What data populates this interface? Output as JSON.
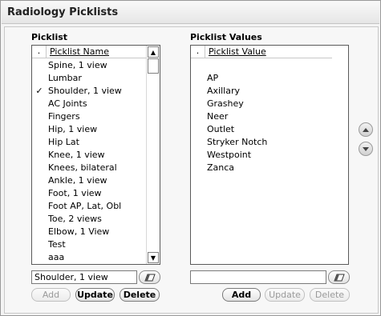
{
  "window": {
    "title": "Radiology Picklists"
  },
  "picklist": {
    "label": "Picklist",
    "header_check": ".",
    "header_name": "Picklist Name",
    "items": [
      {
        "check": "",
        "label": "Spine, 1 view"
      },
      {
        "check": "",
        "label": "Lumbar"
      },
      {
        "check": "✓",
        "label": "Shoulder, 1 view"
      },
      {
        "check": "",
        "label": "AC Joints"
      },
      {
        "check": "",
        "label": "Fingers"
      },
      {
        "check": "",
        "label": "Hip, 1 view"
      },
      {
        "check": "",
        "label": "Hip Lat"
      },
      {
        "check": "",
        "label": "Knee, 1 view"
      },
      {
        "check": "",
        "label": "Knees, bilateral"
      },
      {
        "check": "",
        "label": "Ankle, 1 view"
      },
      {
        "check": "",
        "label": "Foot, 1 view"
      },
      {
        "check": "",
        "label": "Foot AP, Lat, Obl"
      },
      {
        "check": "",
        "label": "Toe, 2 views"
      },
      {
        "check": "",
        "label": "Elbow, 1 View"
      },
      {
        "check": "",
        "label": "Test"
      },
      {
        "check": "",
        "label": "aaa"
      }
    ],
    "edit_value": "Shoulder, 1 view",
    "buttons": {
      "add": "Add",
      "update": "Update",
      "delete": "Delete"
    }
  },
  "values": {
    "label": "Picklist Values",
    "header_check": ".",
    "header_name": "Picklist Value",
    "items": [
      "",
      "AP",
      "Axillary",
      "Grashey",
      "Neer",
      "Outlet",
      "Stryker Notch",
      "Westpoint",
      "Zanca"
    ],
    "edit_value": "",
    "buttons": {
      "add": "Add",
      "update": "Update",
      "delete": "Delete"
    }
  },
  "icons": {
    "eraser": "eraser-icon",
    "move_up": "chevron-up-icon",
    "move_down": "chevron-down-icon",
    "scroll_up": "scroll-up-arrow-icon",
    "scroll_down": "scroll-down-arrow-icon"
  },
  "colors": {
    "disabled_text": "#9a9a9a"
  }
}
